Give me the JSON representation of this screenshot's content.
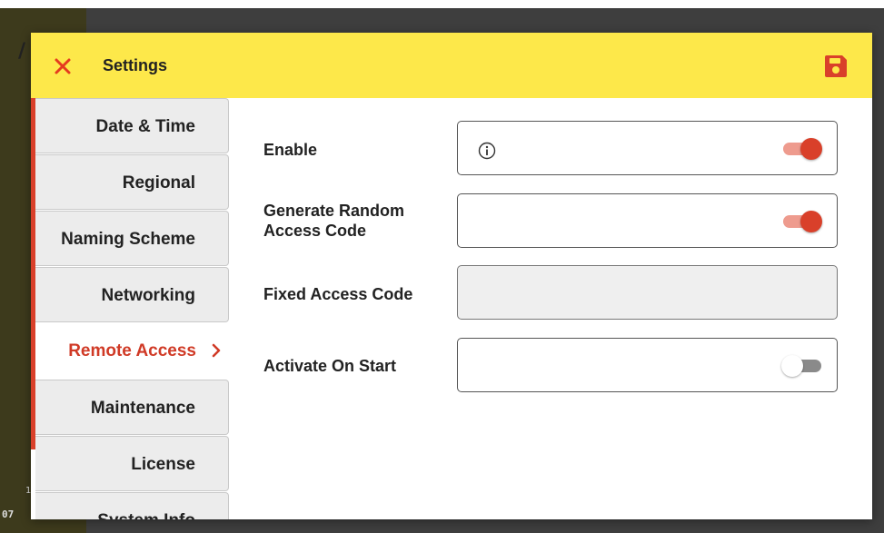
{
  "background": {
    "frag1": "/",
    "frag2": "1",
    "frag3": "07"
  },
  "header": {
    "title": "Settings",
    "close_icon": "close-icon",
    "save_icon": "floppy-disk-icon",
    "close_color": "#e53b1f",
    "save_color": "#d9402a",
    "bg_color": "#fde84a"
  },
  "sidebar": {
    "items": [
      {
        "label": "Date & Time",
        "active": false
      },
      {
        "label": "Regional",
        "active": false
      },
      {
        "label": "Naming Scheme",
        "active": false
      },
      {
        "label": "Networking",
        "active": false
      },
      {
        "label": "Remote Access",
        "active": true,
        "chevron": ">"
      },
      {
        "label": "Maintenance",
        "active": false
      },
      {
        "label": "License",
        "active": false
      },
      {
        "label": "System Info",
        "active": false
      }
    ],
    "accent_color": "#d9402a"
  },
  "content": {
    "enable": {
      "label": "Enable",
      "info_icon": "info-icon",
      "toggle_on": true
    },
    "random_code": {
      "label_line1": "Generate Random",
      "label_line2": "Access Code",
      "toggle_on": true
    },
    "fixed_code": {
      "label": "Fixed Access Code",
      "value": "",
      "disabled": true
    },
    "activate": {
      "label": "Activate On Start",
      "toggle_on": false
    }
  }
}
